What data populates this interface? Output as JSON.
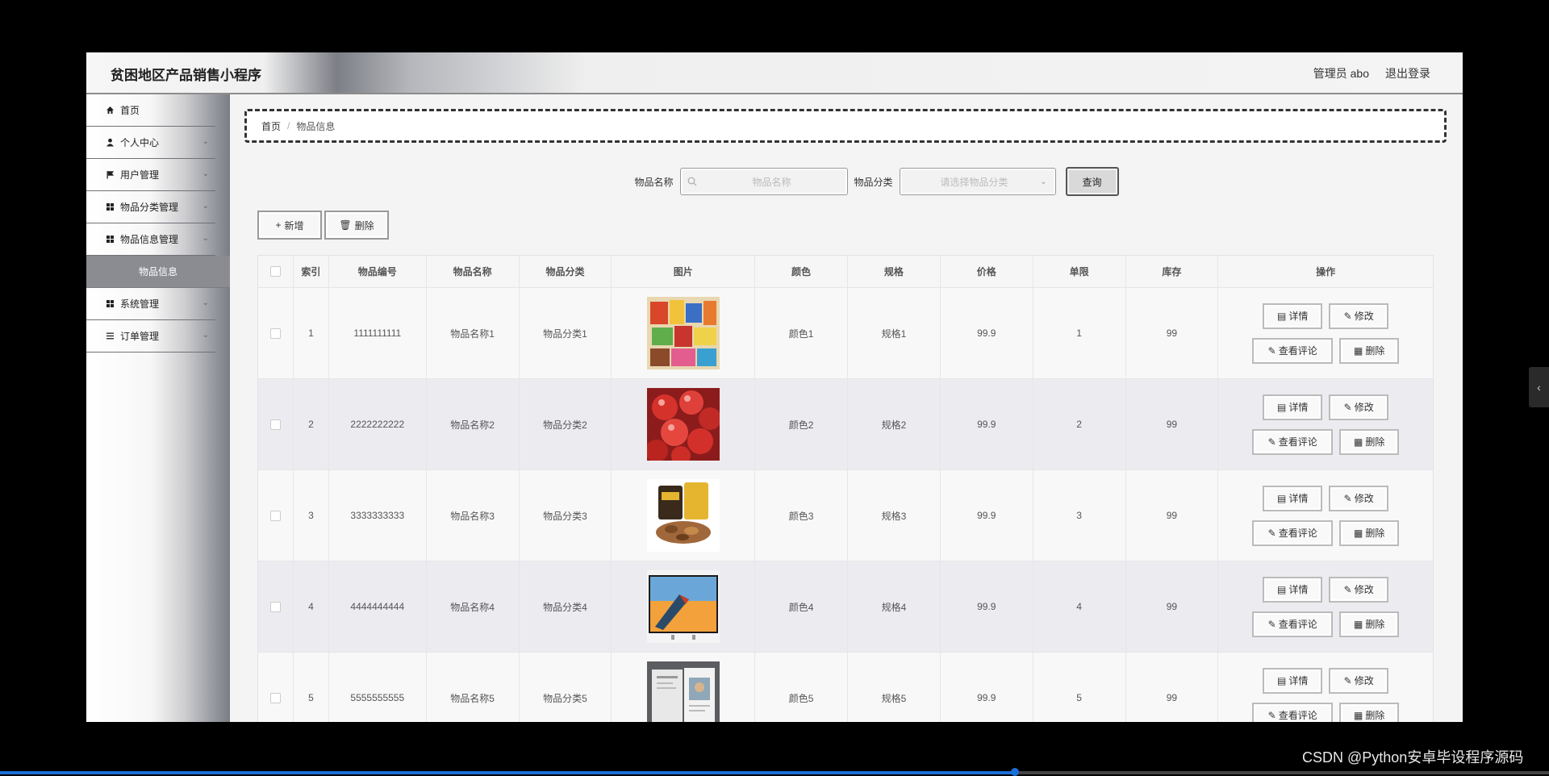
{
  "header": {
    "title": "贫困地区产品销售小程序",
    "user": "管理员 abo",
    "logout": "退出登录"
  },
  "sidebar": {
    "items": [
      {
        "label": "首页",
        "icon": "home-icon",
        "chevron": false
      },
      {
        "label": "个人中心",
        "icon": "user-icon",
        "chevron": true
      },
      {
        "label": "用户管理",
        "icon": "flag-icon",
        "chevron": true
      },
      {
        "label": "物品分类管理",
        "icon": "grid-icon",
        "chevron": true
      },
      {
        "label": "物品信息管理",
        "icon": "grid-icon",
        "chevron": true
      },
      {
        "label": "物品信息",
        "sub": true
      },
      {
        "label": "系统管理",
        "icon": "grid-icon",
        "chevron": true
      },
      {
        "label": "订单管理",
        "icon": "list-icon",
        "chevron": true
      }
    ]
  },
  "breadcrumb": {
    "home": "首页",
    "sep": "/",
    "current": "物品信息"
  },
  "filters": {
    "name_label": "物品名称",
    "name_placeholder": "物品名称",
    "cat_label": "物品分类",
    "cat_placeholder": "请选择物品分类",
    "query": "查询"
  },
  "actions": {
    "add": "新增",
    "delete": "删除"
  },
  "table": {
    "headers": [
      "索引",
      "物品编号",
      "物品名称",
      "物品分类",
      "图片",
      "颜色",
      "规格",
      "价格",
      "单限",
      "库存",
      "操作"
    ],
    "rows": [
      {
        "idx": "1",
        "no": "1111111111",
        "name": "物品名称1",
        "cat": "物品分类1",
        "color": "颜色1",
        "spec": "规格1",
        "price": "99.9",
        "limit": "1",
        "stock": "99",
        "img": "snacks"
      },
      {
        "idx": "2",
        "no": "2222222222",
        "name": "物品名称2",
        "cat": "物品分类2",
        "color": "颜色2",
        "spec": "规格2",
        "price": "99.9",
        "limit": "2",
        "stock": "99",
        "img": "cherries"
      },
      {
        "idx": "3",
        "no": "3333333333",
        "name": "物品名称3",
        "cat": "物品分类3",
        "color": "颜色3",
        "spec": "规格3",
        "price": "99.9",
        "limit": "3",
        "stock": "99",
        "img": "nuts"
      },
      {
        "idx": "4",
        "no": "4444444444",
        "name": "物品名称4",
        "cat": "物品分类4",
        "color": "颜色4",
        "spec": "规格4",
        "price": "99.9",
        "limit": "4",
        "stock": "99",
        "img": "tv"
      },
      {
        "idx": "5",
        "no": "5555555555",
        "name": "物品名称5",
        "cat": "物品分类5",
        "color": "颜色5",
        "spec": "规格5",
        "price": "99.9",
        "limit": "5",
        "stock": "99",
        "img": "magazine"
      }
    ],
    "ops": {
      "detail": "详情",
      "edit": "修改",
      "reviews": "查看评论",
      "delete": "删除"
    }
  },
  "watermark": "CSDN @Python安卓毕设程序源码",
  "video_progress": 0.655
}
